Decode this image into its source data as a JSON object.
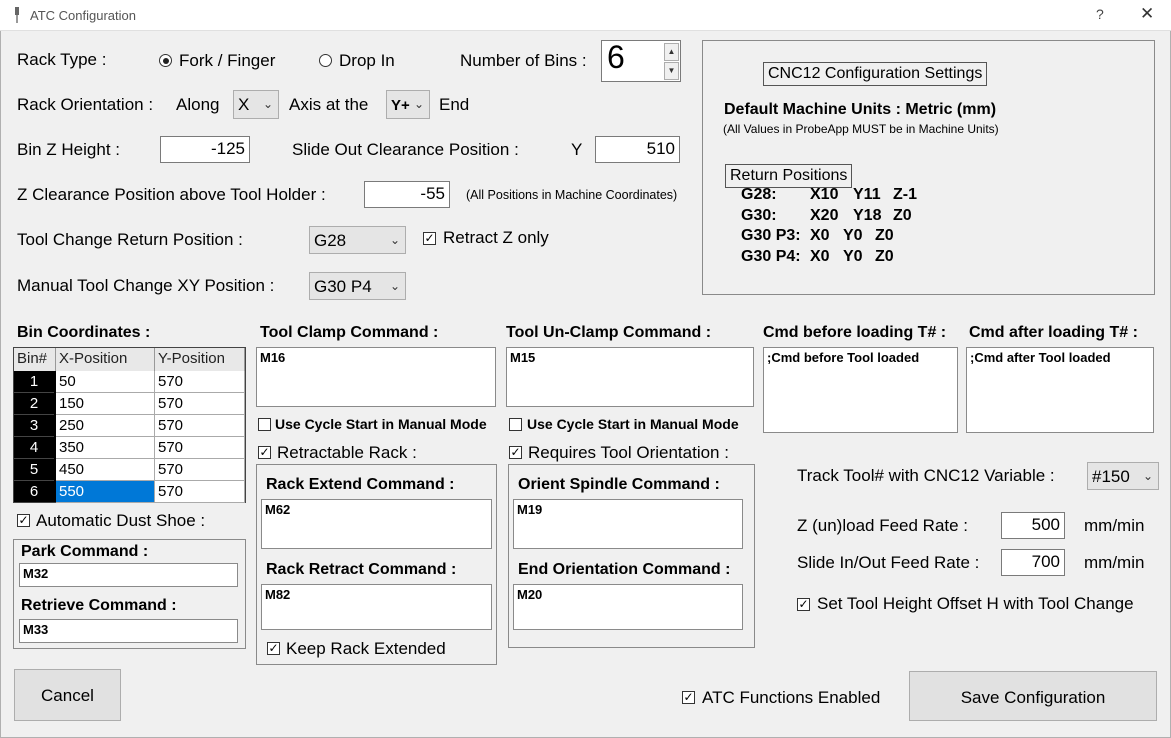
{
  "window": {
    "title": "ATC Configuration",
    "help": "?",
    "close": "✕"
  },
  "rack_type": {
    "label": "Rack Type :",
    "option_fork": "Fork / Finger",
    "option_drop": "Drop In",
    "selected": "Fork / Finger"
  },
  "bins": {
    "label": "Number of Bins :",
    "value": "6"
  },
  "rack_orientation": {
    "label": "Rack Orientation :",
    "along": "Along",
    "axis_value": "X",
    "axis_at": "Axis at the",
    "end_value": "Y+",
    "end": "End"
  },
  "bin_z": {
    "label": "Bin Z Height :",
    "value": "-125"
  },
  "slide_out": {
    "label": "Slide Out Clearance Position :",
    "axis": "Y",
    "value": "510"
  },
  "z_clear": {
    "label": "Z Clearance Position above Tool Holder :",
    "value": "-55",
    "note": "(All Positions in Machine Coordinates)"
  },
  "tool_change_return": {
    "label": "Tool Change Return Position :",
    "value": "G28",
    "retract_label": "Retract Z only",
    "retract_checked": true
  },
  "manual_tc": {
    "label": "Manual Tool Change XY Position :",
    "value": "G30 P4"
  },
  "cnc12": {
    "button": "CNC12 Configuration Settings",
    "units": "Default Machine Units : Metric (mm)",
    "units_note": "(All Values in ProbeApp MUST be in Machine Units)",
    "return_title": "Return Positions",
    "rows": [
      {
        "name": "G28:",
        "x": "X10",
        "y": "Y11",
        "z": "Z-1"
      },
      {
        "name": "G30:",
        "x": "X20",
        "y": "Y18",
        "z": "Z0"
      },
      {
        "name": "G30 P3:",
        "x": "X0",
        "y": "Y0",
        "z": "Z0"
      },
      {
        "name": "G30 P4:",
        "x": "X0",
        "y": "Y0",
        "z": "Z0"
      }
    ]
  },
  "bin_coords": {
    "label": "Bin Coordinates :",
    "headers": [
      "Bin#",
      "X-Position",
      "Y-Position"
    ],
    "rows": [
      {
        "n": "1",
        "x": "50",
        "y": "570"
      },
      {
        "n": "2",
        "x": "150",
        "y": "570"
      },
      {
        "n": "3",
        "x": "250",
        "y": "570"
      },
      {
        "n": "4",
        "x": "350",
        "y": "570"
      },
      {
        "n": "5",
        "x": "450",
        "y": "570"
      },
      {
        "n": "6",
        "x": "550",
        "y": "570"
      }
    ]
  },
  "clamp": {
    "label": "Tool Clamp Command :",
    "value": "M16",
    "cycle_label": "Use Cycle Start in Manual Mode"
  },
  "unclamp": {
    "label": "Tool Un-Clamp Command :",
    "value": "M15",
    "cycle_label": "Use Cycle Start in Manual Mode"
  },
  "cmd_before": {
    "label": "Cmd before loading T# :",
    "value": ";Cmd before Tool loaded"
  },
  "cmd_after": {
    "label": "Cmd after loading T# :",
    "value": ";Cmd after Tool loaded"
  },
  "dust_shoe": {
    "label": "Automatic Dust Shoe :",
    "park_label": "Park Command :",
    "park_value": "M32",
    "retrieve_label": "Retrieve Command :",
    "retrieve_value": "M33"
  },
  "retractable": {
    "label": "Retractable Rack :",
    "extend_label": "Rack Extend Command :",
    "extend_value": "M62",
    "retract_label": "Rack Retract Command :",
    "retract_value": "M82",
    "keep_label": "Keep Rack Extended"
  },
  "orientation": {
    "label": "Requires Tool Orientation :",
    "orient_label": "Orient Spindle Command :",
    "orient_value": "M19",
    "end_label": "End Orientation Command :",
    "end_value": "M20"
  },
  "track": {
    "label": "Track Tool# with CNC12 Variable :",
    "value": "#150"
  },
  "z_feed": {
    "label": "Z (un)load Feed Rate :",
    "value": "500",
    "unit": "mm/min"
  },
  "slide_feed": {
    "label": "Slide In/Out Feed Rate :",
    "value": "700",
    "unit": "mm/min"
  },
  "height_offset": {
    "label": "Set Tool Height Offset H with Tool Change"
  },
  "atc_enabled": {
    "label": "ATC Functions Enabled"
  },
  "buttons": {
    "cancel": "Cancel",
    "save": "Save Configuration"
  },
  "check_mark": "✓",
  "chevron": "⌄"
}
